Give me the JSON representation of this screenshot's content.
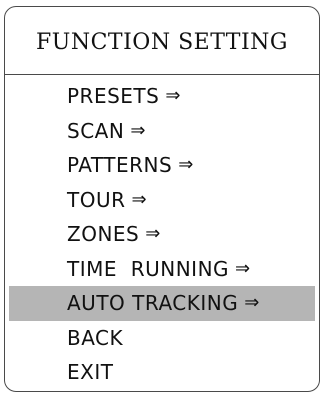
{
  "menu": {
    "title": "FUNCTION SETTING",
    "selected_index": 6,
    "items": [
      {
        "label": "PRESETS",
        "arrow": "⇒",
        "has_submenu": true
      },
      {
        "label": "SCAN",
        "arrow": "⇒",
        "has_submenu": true
      },
      {
        "label": "PATTERNS",
        "arrow": "⇒",
        "has_submenu": true
      },
      {
        "label": "TOUR",
        "arrow": "⇒",
        "has_submenu": true
      },
      {
        "label": "ZONES",
        "arrow": "⇒",
        "has_submenu": true
      },
      {
        "label": "TIME  RUNNING",
        "arrow": "⇒",
        "has_submenu": true
      },
      {
        "label": "AUTO TRACKING",
        "arrow": "⇒",
        "has_submenu": true
      },
      {
        "label": "BACK",
        "arrow": "",
        "has_submenu": false
      },
      {
        "label": "EXIT",
        "arrow": "",
        "has_submenu": false
      }
    ],
    "colors": {
      "background": "#ffffff",
      "text": "#111111",
      "border": "#4a4a4a",
      "highlight": "#b5b5b5"
    }
  }
}
